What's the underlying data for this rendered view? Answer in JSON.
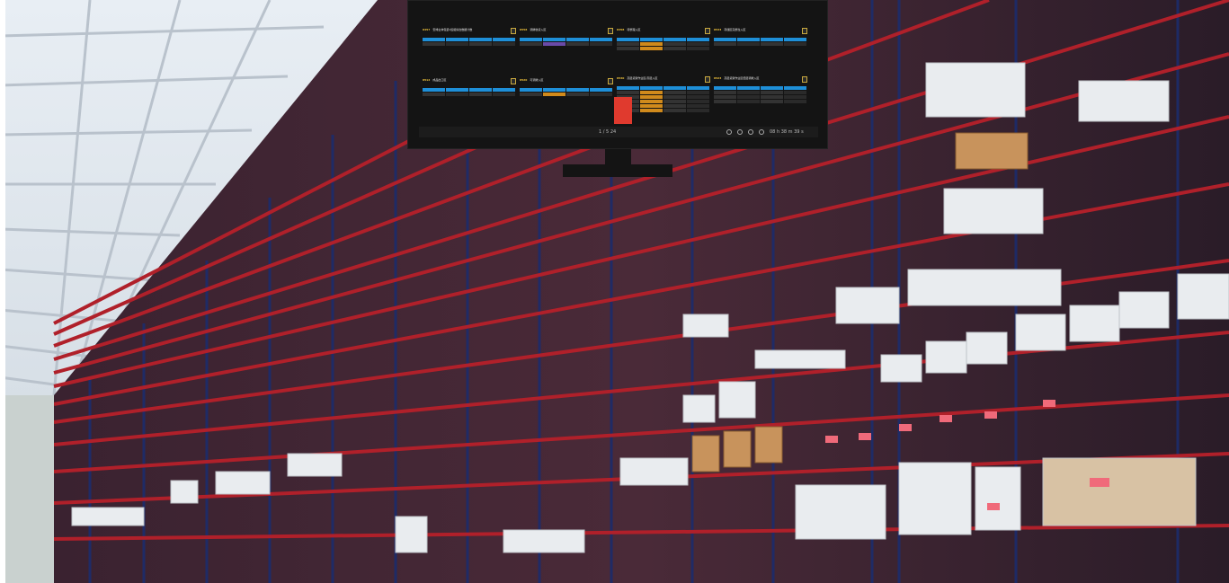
{
  "monitor": {
    "page_indicator": "1 / 5   24",
    "clock": "08 h 38 m 39 s",
    "status_icons": [
      "settings-icon",
      "circle-icon",
      "circle-icon",
      "power-icon"
    ]
  },
  "cards": [
    {
      "id": "8457",
      "title": "安排主体包装1班组综合数据计数"
    },
    {
      "id": "8558",
      "title": "调拨收货入区"
    },
    {
      "id": "8458",
      "title": "待整理入区"
    },
    {
      "id": "8533",
      "title": "存储区完整性入区"
    },
    {
      "id": "8512",
      "title": "成品出口区"
    },
    {
      "id": "8520",
      "title": "可调拨入区"
    },
    {
      "id": "8530",
      "title": "高层货架作业区/高层入区"
    },
    {
      "id": "8523",
      "title": "高层货架作业区低层调拨入区"
    }
  ],
  "colors": {
    "header_blue": "#1e8fd8",
    "alert_red": "#e03a2e",
    "rack_red": "#b0202a",
    "rack_blue": "#1c2c6c",
    "wood": "#c8935c",
    "monitor_bg": "#141414"
  }
}
